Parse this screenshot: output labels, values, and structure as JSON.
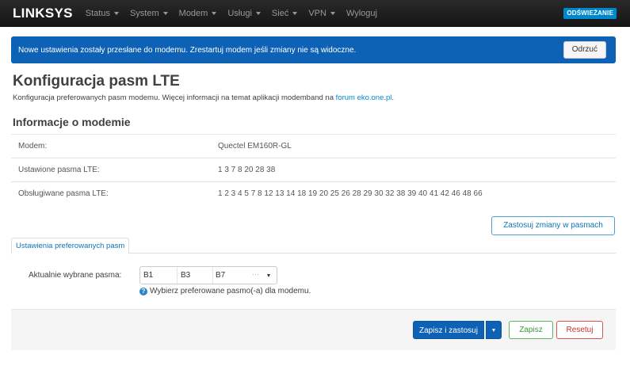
{
  "navbar": {
    "brand": "LINKSYS",
    "items": [
      {
        "label": "Status",
        "has_caret": true
      },
      {
        "label": "System",
        "has_caret": true
      },
      {
        "label": "Modem",
        "has_caret": true
      },
      {
        "label": "Usługi",
        "has_caret": true
      },
      {
        "label": "Sieć",
        "has_caret": true
      },
      {
        "label": "VPN",
        "has_caret": true
      },
      {
        "label": "Wyloguj",
        "has_caret": false
      }
    ],
    "refresh_label": "ODŚWIEŻANIE"
  },
  "alert": {
    "message": "Nowe ustawienia zostały przesłane do modemu. Zrestartuj modem jeśli zmiany nie są widoczne.",
    "dismiss_label": "Odrzuć"
  },
  "page": {
    "title": "Konfiguracja pasm LTE",
    "description_prefix": "Konfiguracja preferowanych pasm modemu. Więcej informacji na temat aplikacji modemband na ",
    "description_link": "forum eko.one.pl",
    "description_suffix": "."
  },
  "modem_info": {
    "section_title": "Informacje o modemie",
    "rows": [
      {
        "label": "Modem:",
        "value": "Quectel EM160R-GL"
      },
      {
        "label": "Ustawione pasma LTE:",
        "value": "1 3 7 8 20 28 38"
      },
      {
        "label": "Obsługiwane pasma LTE:",
        "value": "1 2 3 4 5 7 8 12 13 14 18 19 20 25 26 28 29 30 32 38 39 40 41 42 46 48 66"
      }
    ],
    "apply_button": "Zastosuj zmiany w pasmach"
  },
  "tabs": {
    "preferred": "Ustawienia preferowanych pasm"
  },
  "form": {
    "label": "Aktualnie wybrane pasma:",
    "selected_bands": [
      "B1",
      "B3",
      "B7"
    ],
    "more_indicator": "···",
    "help": "Wybierz preferowane pasmo(-a) dla modemu."
  },
  "footer": {
    "save_apply": "Zapisz i zastosuj",
    "save": "Zapisz",
    "reset": "Resetuj"
  },
  "colors": {
    "navbar_bg": "#1f1f1f",
    "primary": "#0e62b5",
    "link": "#0088cc",
    "success": "#5bb75b",
    "danger": "#d9534f"
  }
}
